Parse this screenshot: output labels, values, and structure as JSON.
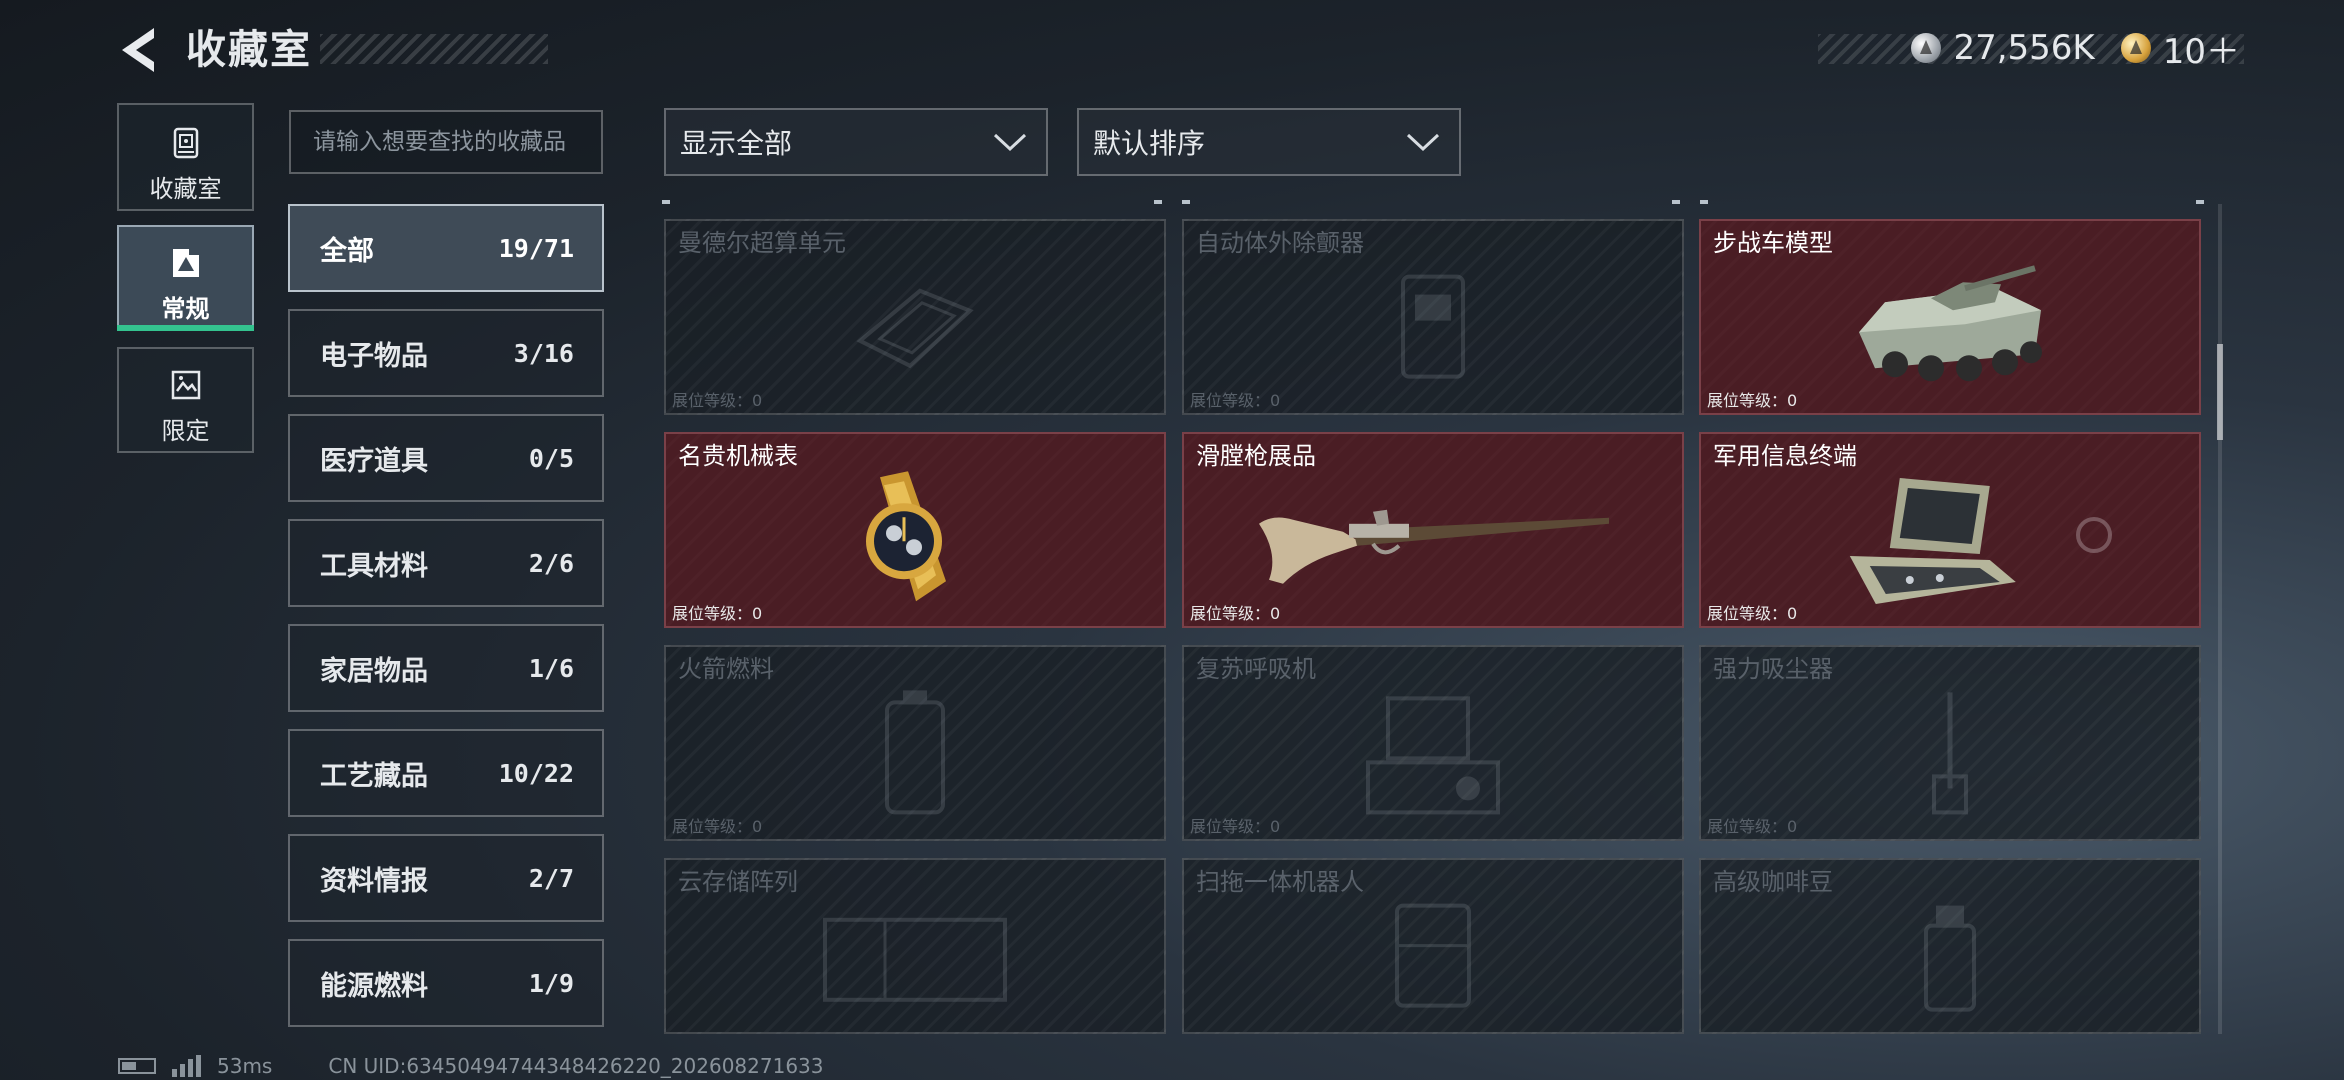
{
  "header": {
    "title": "收藏室",
    "currency_silver": "27,556K",
    "currency_gold": "10＋"
  },
  "side_tabs": [
    {
      "label": "收藏室",
      "icon": "vault-icon",
      "active": false
    },
    {
      "label": "常规",
      "icon": "exhibit-icon",
      "active": true
    },
    {
      "label": "限定",
      "icon": "limited-icon",
      "active": false
    }
  ],
  "search": {
    "placeholder": "请输入想要查找的收藏品"
  },
  "categories": [
    {
      "label": "全部",
      "count": "19/71",
      "active": true
    },
    {
      "label": "电子物品",
      "count": "3/16"
    },
    {
      "label": "医疗道具",
      "count": "0/5"
    },
    {
      "label": "工具材料",
      "count": "2/6"
    },
    {
      "label": "家居物品",
      "count": "1/6"
    },
    {
      "label": "工艺藏品",
      "count": "10/22"
    },
    {
      "label": "资料情报",
      "count": "2/7"
    },
    {
      "label": "能源燃料",
      "count": "1/9"
    }
  ],
  "filters": {
    "show": "显示全部",
    "sort": "默认排序"
  },
  "level_label": "展位等级：",
  "items": [
    {
      "name": "曼德尔超算单元",
      "level": "0",
      "unlocked": false,
      "icon": "supercomputer-icon"
    },
    {
      "name": "自动体外除颤器",
      "level": "0",
      "unlocked": false,
      "icon": "defibrillator-icon"
    },
    {
      "name": "步战车模型",
      "level": "0",
      "unlocked": true,
      "icon": "ifv-model-icon"
    },
    {
      "name": "名贵机械表",
      "level": "0",
      "unlocked": true,
      "icon": "gold-watch-icon"
    },
    {
      "name": "滑膛枪展品",
      "level": "0",
      "unlocked": true,
      "icon": "musket-icon"
    },
    {
      "name": "军用信息终端",
      "level": "0",
      "unlocked": true,
      "icon": "military-terminal-icon"
    },
    {
      "name": "火箭燃料",
      "level": "0",
      "unlocked": false,
      "icon": "rocket-fuel-icon"
    },
    {
      "name": "复苏呼吸机",
      "level": "0",
      "unlocked": false,
      "icon": "ventilator-icon"
    },
    {
      "name": "强力吸尘器",
      "level": "0",
      "unlocked": false,
      "icon": "vacuum-icon"
    },
    {
      "name": "云存储阵列",
      "level": "",
      "unlocked": false,
      "icon": "storage-array-icon"
    },
    {
      "name": "扫拖一体机器人",
      "level": "",
      "unlocked": false,
      "icon": "robot-vacuum-icon"
    },
    {
      "name": "高级咖啡豆",
      "level": "",
      "unlocked": false,
      "icon": "coffee-beans-icon"
    }
  ],
  "footer": {
    "ping": "53ms",
    "uid": "CN UID:634504947443484262​20_202608271633"
  }
}
